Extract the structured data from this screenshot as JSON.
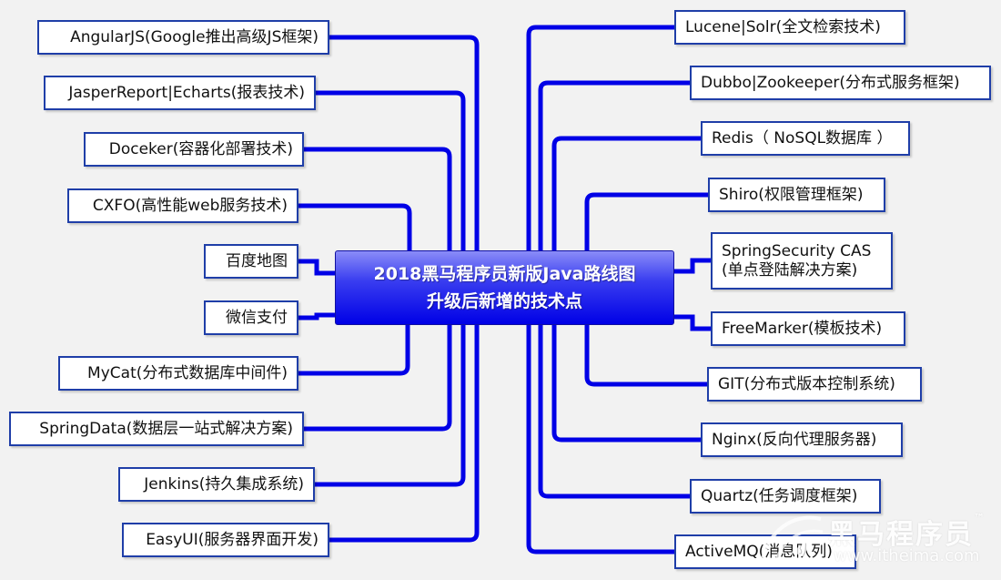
{
  "center": {
    "line1": "2018黑马程序员新版Java路线图",
    "line2": "升级后新增的技术点"
  },
  "left_nodes": [
    {
      "id": "angularjs",
      "label": "AngularJS(Google推出高级JS框架)"
    },
    {
      "id": "jasperreport",
      "label": "JasperReport|Echarts(报表技术)"
    },
    {
      "id": "docker",
      "label": "Doceker(容器化部署技术)"
    },
    {
      "id": "cxfo",
      "label": "CXFO(高性能web服务技术)"
    },
    {
      "id": "baidu-map",
      "label": "百度地图"
    },
    {
      "id": "wechat-pay",
      "label": "微信支付"
    },
    {
      "id": "mycat",
      "label": "MyCat(分布式数据库中间件)"
    },
    {
      "id": "springdata",
      "label": "SpringData(数据层一站式解决方案)"
    },
    {
      "id": "jenkins",
      "label": "Jenkins(持久集成系统)"
    },
    {
      "id": "easyui",
      "label": "EasyUI(服务器界面开发)"
    }
  ],
  "right_nodes": [
    {
      "id": "lucene",
      "label": "Lucene|Solr(全文检索技术)"
    },
    {
      "id": "dubbo",
      "label": "Dubbo|Zookeeper(分布式服务框架)"
    },
    {
      "id": "redis",
      "label": "Redis（ NoSQL数据库 ）"
    },
    {
      "id": "shiro",
      "label": "Shiro(权限管理框架)"
    },
    {
      "id": "springsecurity",
      "label": "SpringSecurity CAS\n(单点登陆解决方案)"
    },
    {
      "id": "freemarker",
      "label": "FreeMarker(模板技术)"
    },
    {
      "id": "git",
      "label": "GIT(分布式版本控制系统)"
    },
    {
      "id": "nginx",
      "label": "Nginx(反向代理服务器)"
    },
    {
      "id": "quartz",
      "label": "Quartz(任务调度框架)"
    },
    {
      "id": "activemq",
      "label": "ActiveMQ(消息队列)"
    }
  ],
  "colors": {
    "connector": "#0000e6",
    "node_border": "#1f3ea8",
    "background": "#f2f2f2"
  },
  "watermark": {
    "brand": "黑马程序员",
    "url": "www.itheima.com",
    "tm": "™"
  }
}
